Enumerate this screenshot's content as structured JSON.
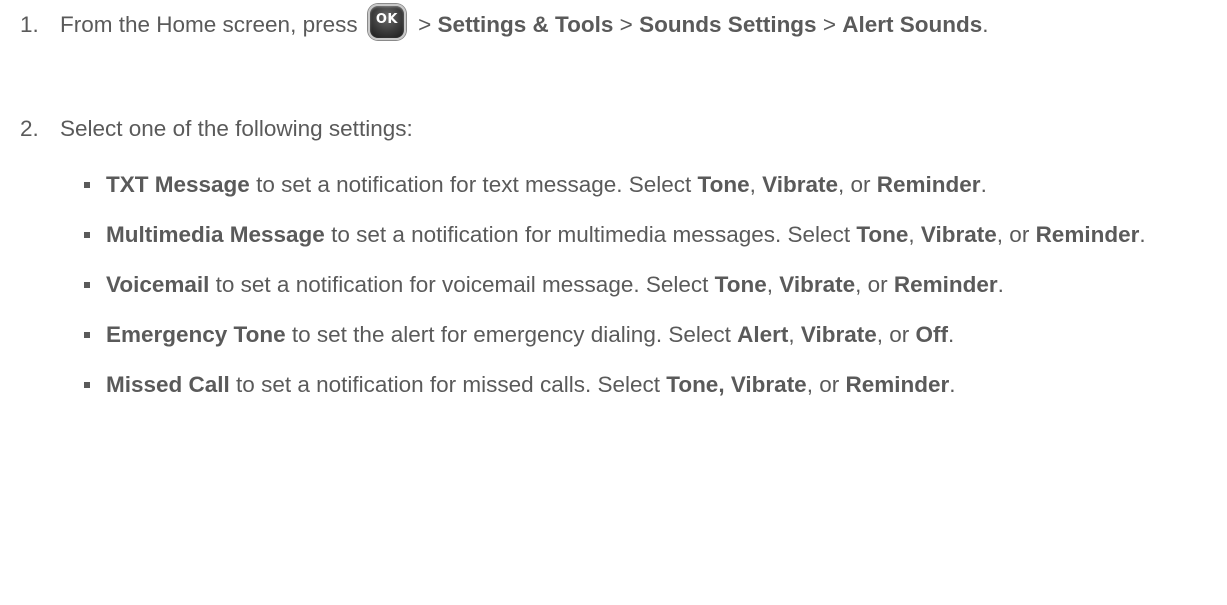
{
  "step1": {
    "number": "1.",
    "prefix": "From the Home screen, press",
    "ok_key_label": "OK",
    "sep1": ">",
    "path1": "Settings & Tools",
    "sep2": ">",
    "path2": "Sounds Settings",
    "sep3": ">",
    "path3": "Alert Sounds",
    "suffix": "."
  },
  "step2": {
    "number": "2.",
    "text": "Select one of the following settings:"
  },
  "bullets": [
    {
      "term": "TXT Message",
      "desc": " to set a notification for text message. Select ",
      "opt1": "Tone",
      "sep1": ", ",
      "opt2": "Vibrate",
      "sep2": ", or ",
      "opt3": "Reminder",
      "end": "."
    },
    {
      "term": "Multimedia Message",
      "desc": " to set a notification for multimedia messages. Select ",
      "opt1": "Tone",
      "sep1": ", ",
      "opt2": "Vibrate",
      "sep2": ", or ",
      "opt3": "Reminder",
      "end": "."
    },
    {
      "term": "Voicemail",
      "desc": " to set a notification for voicemail message. Select ",
      "opt1": "Tone",
      "sep1": ", ",
      "opt2": "Vibrate",
      "sep2": ", or ",
      "opt3": "Reminder",
      "end": "."
    },
    {
      "term": "Emergency Tone",
      "desc": " to set the alert for emergency dialing. Select ",
      "opt1": "Alert",
      "sep1": ", ",
      "opt2": "Vibrate",
      "sep2": ", or ",
      "opt3": "Off",
      "end": "."
    },
    {
      "term": "Missed Call",
      "desc": " to set a notification for missed calls. Select ",
      "opt1": "Tone, Vibrate",
      "sep1": "",
      "opt2": "",
      "sep2": ", or ",
      "opt3": "Reminder",
      "end": "."
    }
  ],
  "colors": {
    "text": "#5a5a5a",
    "ok_key": "#3a3a3a"
  },
  "icons": {
    "ok_key": "ok-key-icon",
    "bullet": "square-bullet-icon"
  }
}
